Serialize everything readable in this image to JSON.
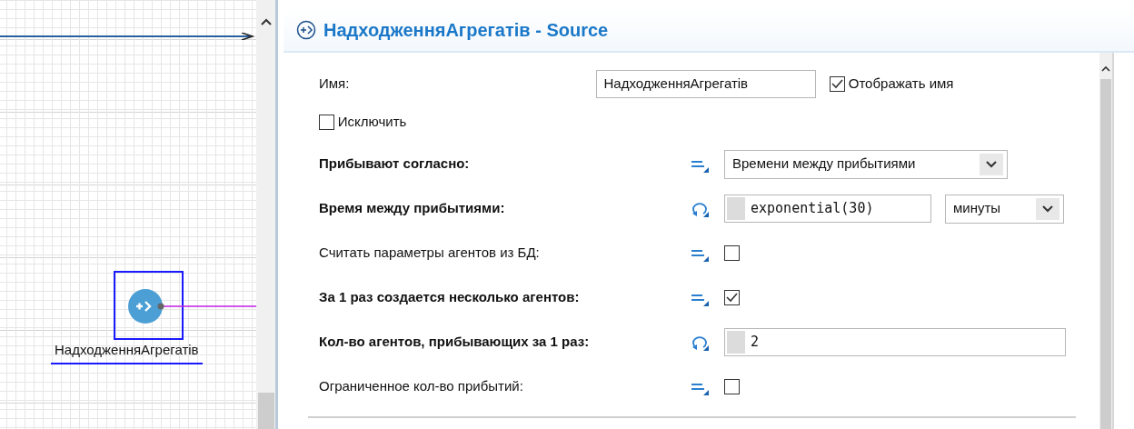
{
  "canvas": {
    "block": {
      "label": "НадходженняАгрегатів",
      "selected": true
    }
  },
  "panel": {
    "title": "НадходженняАгрегатів - Source",
    "name_field": {
      "label": "Имя:",
      "value": "НадходженняАгрегатів"
    },
    "show_name": {
      "label": "Отображать имя",
      "checked": true
    },
    "exclude": {
      "label": "Исключить",
      "checked": false
    },
    "properties": [
      {
        "label": "Прибывают согласно:",
        "bold": true,
        "kind": "select",
        "value": "Времени между прибытиями"
      },
      {
        "label": "Время между прибытиями:",
        "bold": true,
        "kind": "code_units",
        "value": "exponential(30)",
        "units": "минуты"
      },
      {
        "label": "Считать параметры агентов из БД:",
        "bold": false,
        "kind": "checkbox",
        "checked": false
      },
      {
        "label": "За 1 раз создается несколько агентов:",
        "bold": true,
        "kind": "checkbox",
        "checked": true
      },
      {
        "label": "Кол-во агентов, прибывающих за 1 раз:",
        "bold": true,
        "kind": "code",
        "value": "2"
      },
      {
        "label": "Ограниченное кол-во прибытий:",
        "bold": false,
        "kind": "checkbox",
        "checked": false
      }
    ]
  }
}
